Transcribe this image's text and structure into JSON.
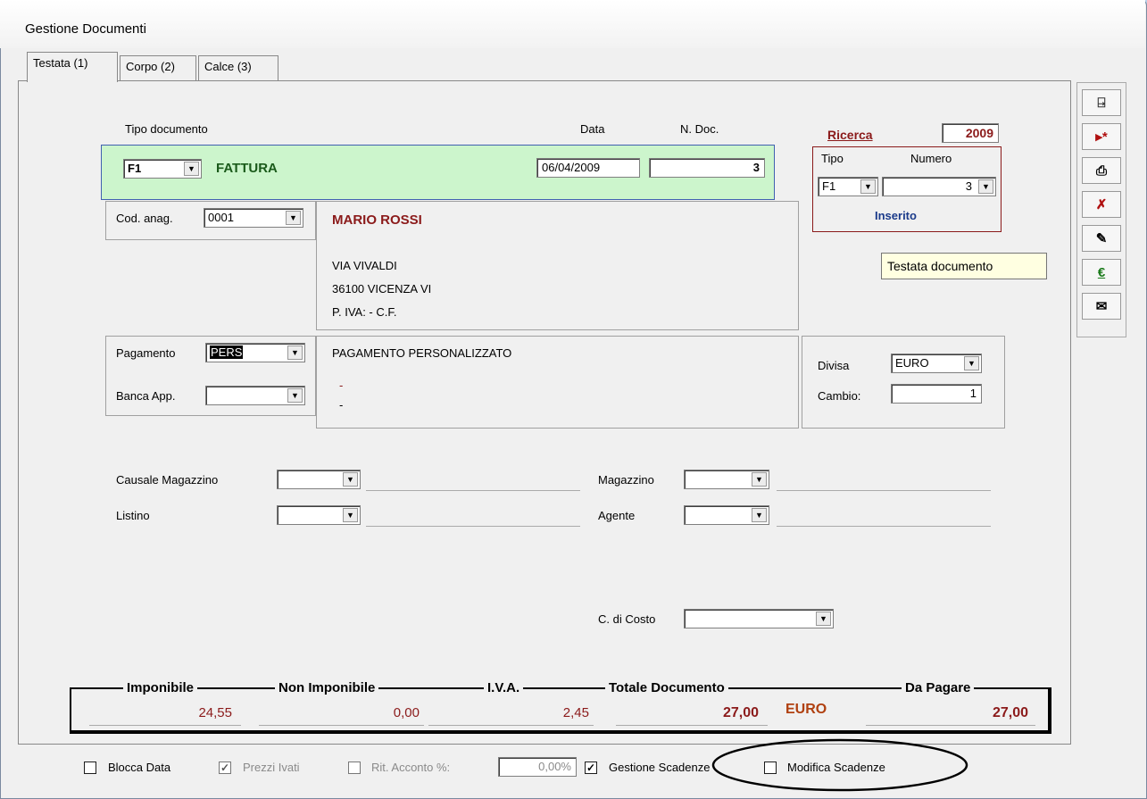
{
  "window": {
    "title": "Gestione Documenti"
  },
  "tabs": [
    {
      "label": "Testata (1)"
    },
    {
      "label": "Corpo (2)"
    },
    {
      "label": "Calce (3)"
    }
  ],
  "header": {
    "tipo_documento_label": "Tipo documento",
    "data_label": "Data",
    "ndoc_label": "N. Doc.",
    "tipo_code": "F1",
    "tipo_desc": "FATTURA",
    "data_value": "06/04/2009",
    "ndoc_value": "3"
  },
  "ricerca": {
    "label": "Ricerca",
    "year": "2009",
    "tipo_label": "Tipo",
    "numero_label": "Numero",
    "tipo_value": "F1",
    "numero_value": "3",
    "status": "Inserito"
  },
  "tooltip": "Testata documento",
  "anag": {
    "label": "Cod. anag.",
    "code": "0001",
    "name": "MARIO ROSSI",
    "address1": "VIA VIVALDI",
    "address2": "36100 VICENZA VI",
    "piva": "P. IVA:  - C.F."
  },
  "pagamento": {
    "label": "Pagamento",
    "code": "PERS",
    "desc": "PAGAMENTO PERSONALIZZATO",
    "banca_label": "Banca App.",
    "banca_value": "",
    "dash1": "-",
    "dash2": "-"
  },
  "divisa": {
    "label": "Divisa",
    "value": "EURO",
    "cambio_label": "Cambio:",
    "cambio_value": "1"
  },
  "fields": {
    "causale_label": "Causale Magazzino",
    "listino_label": "Listino",
    "magazzino_label": "Magazzino",
    "agente_label": "Agente",
    "costo_label": "C. di Costo"
  },
  "totals": {
    "imponibile_label": "Imponibile",
    "non_imponibile_label": "Non Imponibile",
    "iva_label": "I.V.A.",
    "totale_label": "Totale Documento",
    "da_pagare_label": "Da Pagare",
    "imponibile": "24,55",
    "non_imponibile": "0,00",
    "iva": "2,45",
    "totale": "27,00",
    "currency": "EURO",
    "da_pagare": "27,00"
  },
  "footer": {
    "blocca_data": "Blocca Data",
    "prezzi_ivati": "Prezzi Ivati",
    "rit_acconto": "Rit. Acconto %:",
    "rit_value": "0,00%",
    "gestione_scadenze": "Gestione Scadenze",
    "modifica_scadenze": "Modifica Scadenze",
    "check_mark": "✓"
  },
  "toolbar": {
    "icons": [
      "exit-icon",
      "new-record-icon",
      "print-icon",
      "delete-icon",
      "edit-icon",
      "euro-icon",
      "email-icon"
    ],
    "euro_glyph": "€"
  },
  "colors": {
    "accent_red": "#8b1a1a",
    "status_blue": "#1a3a8a",
    "header_green": "#ccf5cc"
  }
}
